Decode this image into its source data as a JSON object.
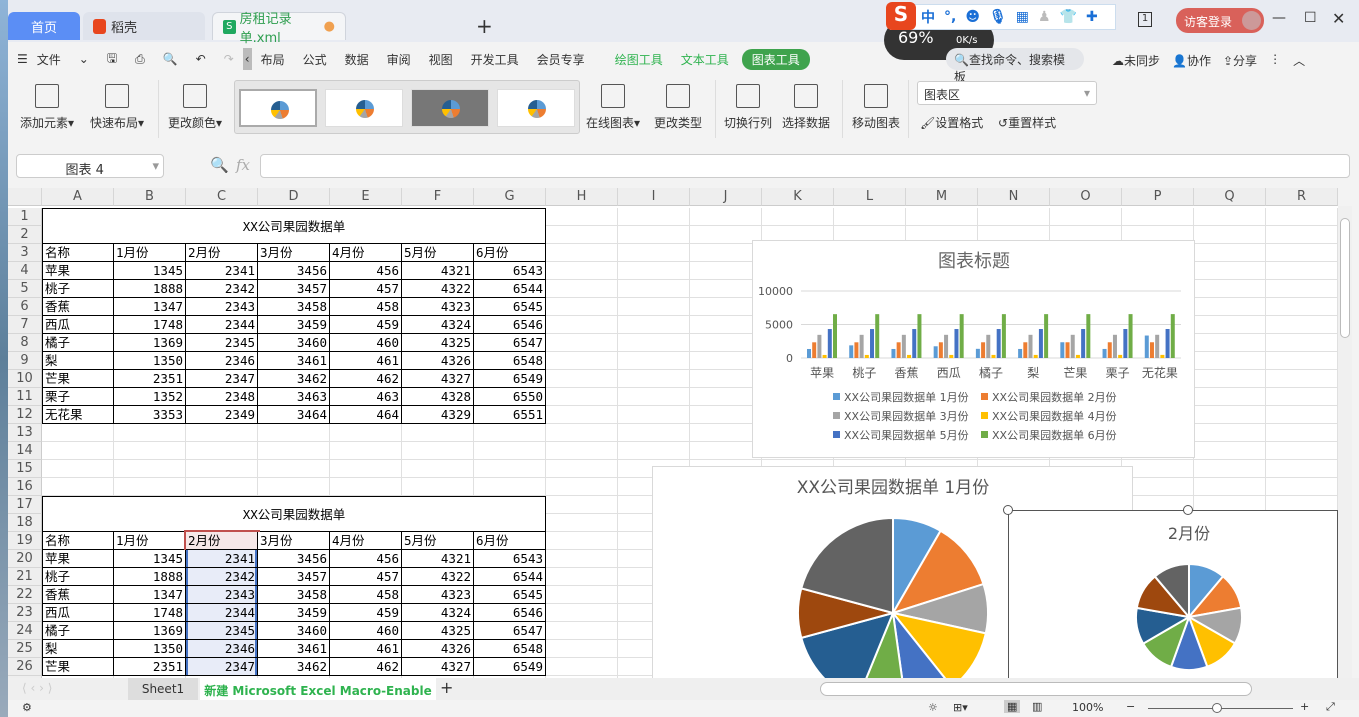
{
  "tabs": {
    "home": "首页",
    "daoke": "稻壳",
    "file": "房租记录单.xml",
    "new": "+"
  },
  "titlebar": {
    "login": "访客登录",
    "page_indicator": "1"
  },
  "ime": {
    "mode": "中",
    "punct": "°,",
    "speed": "0K/s",
    "percent": "69%"
  },
  "menu": {
    "file": "文件",
    "items": [
      "布局",
      "公式",
      "数据",
      "审阅",
      "视图",
      "开发工具",
      "会员专享"
    ],
    "tools": [
      "绘图工具",
      "文本工具"
    ],
    "active_tool": "图表工具",
    "search": "查找命令、搜索模板",
    "sync": "未同步",
    "collab": "协作",
    "share": "分享"
  },
  "ribbon": {
    "add_element": "添加元素",
    "quick_layout": "快速布局",
    "change_color": "更改颜色",
    "online_chart": "在线图表",
    "change_type": "更改类型",
    "switch_rowcol": "切换行列",
    "select_data": "选择数据",
    "move_chart": "移动图表",
    "chart_area": "图表区",
    "set_format": "设置格式",
    "reset_style": "重置样式"
  },
  "formula": {
    "namebox": "图表 4",
    "fx": "fx",
    "value": ""
  },
  "columns": [
    "A",
    "B",
    "C",
    "D",
    "E",
    "F",
    "G",
    "H",
    "I",
    "J",
    "K",
    "L",
    "M",
    "N",
    "O",
    "P",
    "Q",
    "R"
  ],
  "table": {
    "title": "XX公司果园数据单",
    "headers": [
      "名称",
      "1月份",
      "2月份",
      "3月份",
      "4月份",
      "5月份",
      "6月份"
    ],
    "rows": [
      [
        "苹果",
        1345,
        2341,
        3456,
        456,
        4321,
        6543
      ],
      [
        "桃子",
        1888,
        2342,
        3457,
        457,
        4322,
        6544
      ],
      [
        "香蕉",
        1347,
        2343,
        3458,
        458,
        4323,
        6545
      ],
      [
        "西瓜",
        1748,
        2344,
        3459,
        459,
        4324,
        6546
      ],
      [
        "橘子",
        1369,
        2345,
        3460,
        460,
        4325,
        6547
      ],
      [
        "梨",
        1350,
        2346,
        3461,
        461,
        4326,
        6548
      ],
      [
        "芒果",
        2351,
        2347,
        3462,
        462,
        4327,
        6549
      ],
      [
        "栗子",
        1352,
        2348,
        3463,
        463,
        4328,
        6550
      ],
      [
        "无花果",
        3353,
        2349,
        3464,
        464,
        4329,
        6551
      ]
    ]
  },
  "colors": [
    "#5B9BD5",
    "#ED7D31",
    "#A5A5A5",
    "#FFC000",
    "#4472C4",
    "#70AD47",
    "#255E91",
    "#9E480E",
    "#636363"
  ],
  "chart_data": [
    {
      "type": "bar",
      "title": "图表标题",
      "categories": [
        "苹果",
        "桃子",
        "香蕉",
        "西瓜",
        "橘子",
        "梨",
        "芒果",
        "栗子",
        "无花果"
      ],
      "ylim": [
        0,
        10000
      ],
      "yticks": [
        0,
        5000,
        10000
      ],
      "grid": true,
      "legend": "bottom",
      "series": [
        {
          "name": "XX公司果园数据单 1月份",
          "values": [
            1345,
            1888,
            1347,
            1748,
            1369,
            1350,
            2351,
            1352,
            3353
          ]
        },
        {
          "name": "XX公司果园数据单 2月份",
          "values": [
            2341,
            2342,
            2343,
            2344,
            2345,
            2346,
            2347,
            2348,
            2349
          ]
        },
        {
          "name": "XX公司果园数据单 3月份",
          "values": [
            3456,
            3457,
            3458,
            3459,
            3460,
            3461,
            3462,
            3463,
            3464
          ]
        },
        {
          "name": "XX公司果园数据单 4月份",
          "values": [
            456,
            457,
            458,
            459,
            460,
            461,
            462,
            463,
            464
          ]
        },
        {
          "name": "XX公司果园数据单 5月份",
          "values": [
            4321,
            4322,
            4323,
            4324,
            4325,
            4326,
            4327,
            4328,
            4329
          ]
        },
        {
          "name": "XX公司果园数据单 6月份",
          "values": [
            6543,
            6544,
            6545,
            6546,
            6547,
            6548,
            6549,
            6550,
            6551
          ]
        }
      ]
    },
    {
      "type": "pie",
      "title": "XX公司果园数据单 1月份",
      "categories": [
        "苹果",
        "桃子",
        "香蕉",
        "西瓜",
        "橘子",
        "梨",
        "芒果",
        "栗子",
        "无花果"
      ],
      "values": [
        1345,
        1888,
        1347,
        1748,
        1369,
        1350,
        2351,
        1352,
        3353
      ]
    },
    {
      "type": "pie",
      "title": "2月份",
      "categories": [
        "苹果",
        "桃子",
        "香蕉",
        "西瓜",
        "橘子",
        "梨",
        "芒果",
        "栗子",
        "无花果"
      ],
      "values": [
        2341,
        2342,
        2343,
        2344,
        2345,
        2346,
        2347,
        2348,
        2349
      ]
    }
  ],
  "sheets": {
    "sheet1": "Sheet1",
    "active": "新建 Microsoft Excel Macro-Enable",
    "add": "+"
  },
  "status": {
    "zoom": "100%"
  }
}
